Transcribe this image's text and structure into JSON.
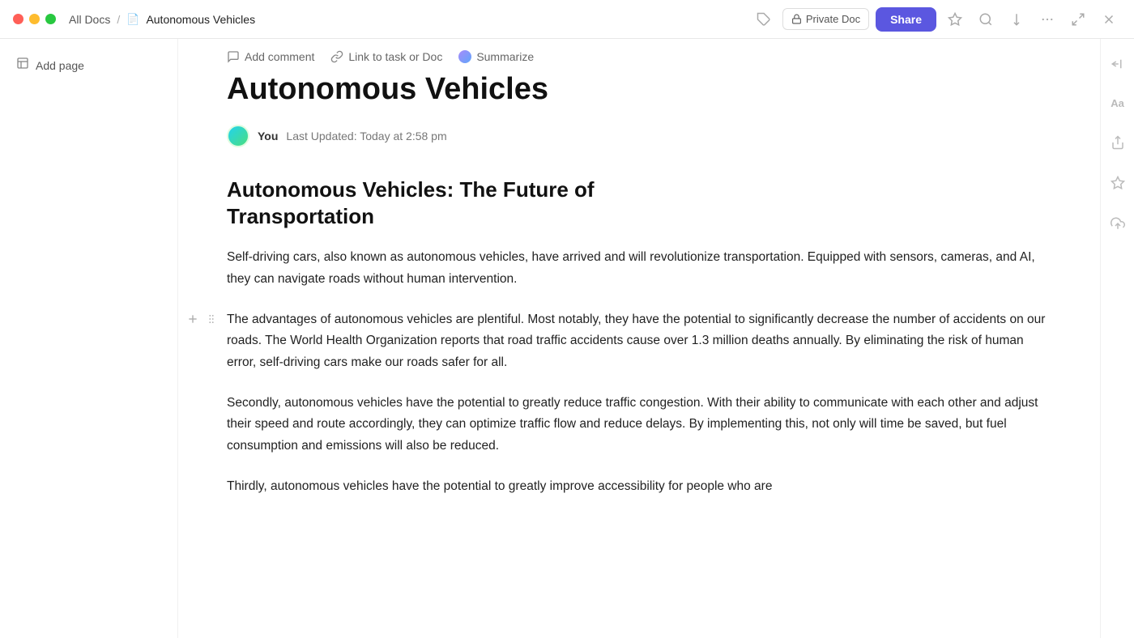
{
  "titlebar": {
    "breadcrumb_all": "All Docs",
    "breadcrumb_separator": "/",
    "doc_title": "Autonomous Vehicles",
    "private_doc_label": "Private Doc",
    "share_label": "Share"
  },
  "toolbar": {
    "add_comment": "Add comment",
    "link_task": "Link to task or Doc",
    "summarize": "Summarize"
  },
  "left_sidebar": {
    "add_page": "Add page"
  },
  "document": {
    "title": "Autonomous Vehicles",
    "author": "You",
    "last_updated": "Last Updated: Today at 2:58 pm",
    "article_heading_line1": "Autonomous Vehicles: The Future of",
    "article_heading_line2": "Transportation",
    "paragraph1": "Self-driving cars, also known as autonomous vehicles, have arrived and will revolutionize transportation. Equipped with sensors, cameras, and AI, they can navigate roads without human intervention.",
    "paragraph2": "The advantages of autonomous vehicles are plentiful. Most notably, they have the potential to significantly decrease the number of accidents on our roads. The World Health Organization reports that road traffic accidents cause over 1.3 million deaths annually. By eliminating the risk of human error, self-driving cars make our roads safer for all.",
    "paragraph3": "Secondly, autonomous vehicles have the potential to greatly reduce traffic congestion. With their ability to communicate with each other and adjust their speed and route accordingly, they can optimize traffic flow and reduce delays. By implementing this, not only will time be saved, but fuel consumption and emissions will also be reduced.",
    "paragraph4": "Thirdly, autonomous vehicles have the potential to greatly improve accessibility for people who are"
  },
  "icons": {
    "window_close": "✕",
    "tag": "🏷",
    "lock": "🔒",
    "star": "☆",
    "search": "○",
    "export": "⬇",
    "more": "•••",
    "expand": "⤢",
    "close": "✕",
    "comment": "◯",
    "link": "↗",
    "add_page": "+",
    "doc": "📄",
    "plus": "+",
    "drag": "⠿",
    "collapse_left": "⇤",
    "font_size": "Aa",
    "share_icon": "↗",
    "magic": "✦",
    "upload": "↑"
  }
}
